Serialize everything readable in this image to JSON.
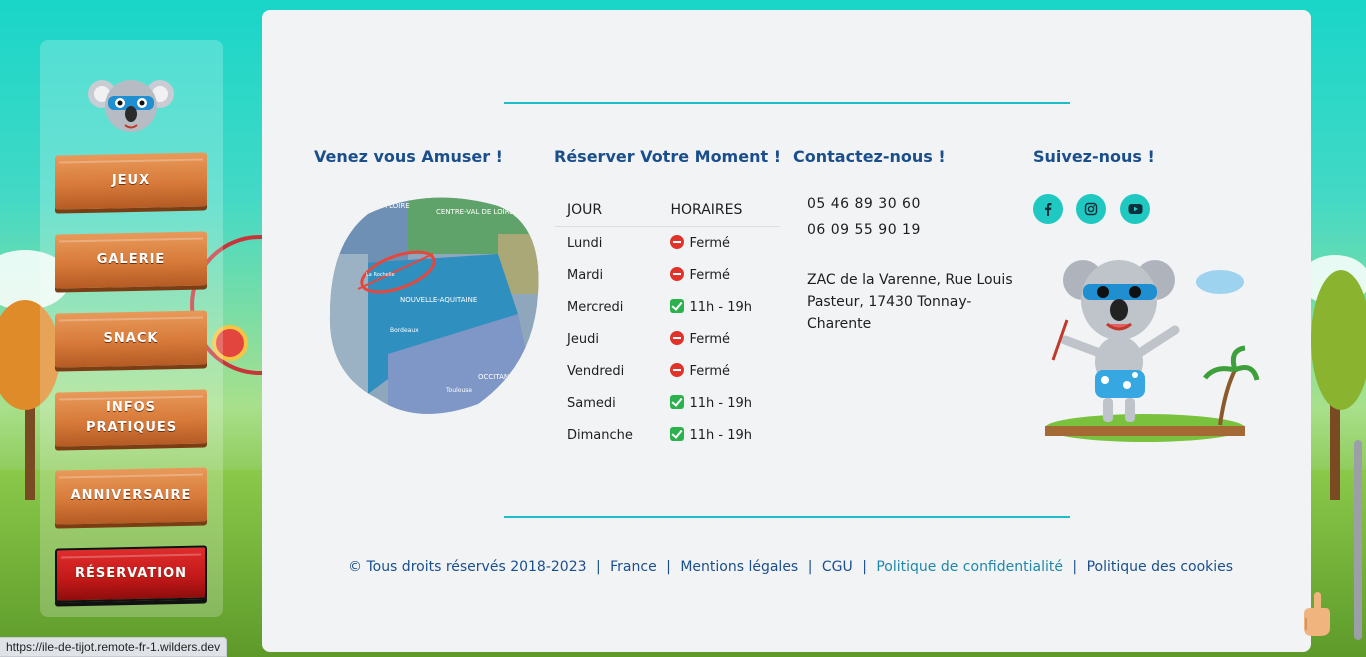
{
  "sidebar": {
    "items": [
      {
        "label": "JEUX"
      },
      {
        "label": "GALERIE"
      },
      {
        "label": "SNACK"
      },
      {
        "label": "INFOS PRATIQUES"
      },
      {
        "label": "ANNIVERSAIRE"
      },
      {
        "label": "RÉSERVATION"
      }
    ]
  },
  "columns": {
    "fun": {
      "title": "Venez vous Amuser !"
    },
    "booking": {
      "title": "Réserver Votre Moment !"
    },
    "contact": {
      "title": "Contactez-nous !"
    },
    "follow": {
      "title": "Suivez-nous !"
    }
  },
  "map_labels": {
    "region1": "DE LA LOIRE",
    "region2": "CENTRE-VAL DE LOIRE",
    "region3": "NOUVELLE-AQUITAINE",
    "city1": "Bordeaux",
    "city2": "La Rochelle",
    "region4": "OCCITANIE",
    "city3": "Toulouse"
  },
  "hours": {
    "col_day": "JOUR",
    "col_hours": "HORAIRES",
    "rows": [
      {
        "day": "Lundi",
        "status": "closed",
        "text": "Fermé"
      },
      {
        "day": "Mardi",
        "status": "closed",
        "text": "Fermé"
      },
      {
        "day": "Mercredi",
        "status": "open",
        "text": "11h - 19h"
      },
      {
        "day": "Jeudi",
        "status": "closed",
        "text": "Fermé"
      },
      {
        "day": "Vendredi",
        "status": "closed",
        "text": "Fermé"
      },
      {
        "day": "Samedi",
        "status": "open",
        "text": "11h - 19h"
      },
      {
        "day": "Dimanche",
        "status": "open",
        "text": "11h - 19h"
      }
    ]
  },
  "contact": {
    "phone1": "05 46 89 30 60",
    "phone2": "06 09 55 90 19",
    "address": "ZAC de la Varenne, Rue Louis Pasteur, 17430 Tonnay-Charente"
  },
  "social": [
    {
      "icon": "facebook-icon"
    },
    {
      "icon": "instagram-icon"
    },
    {
      "icon": "youtube-icon"
    }
  ],
  "footer": {
    "copyright": "© Tous droits réservés 2018-2023",
    "links": [
      {
        "label": "France",
        "style": "dark"
      },
      {
        "label": "Mentions légales",
        "style": "dark"
      },
      {
        "label": "CGU",
        "style": "dark"
      },
      {
        "label": "Politique de confidentialité",
        "style": "teal"
      },
      {
        "label": "Politique des cookies",
        "style": "dark"
      }
    ],
    "separator": "|"
  },
  "status_bar": {
    "url": "https://ile-de-tijot.remote-fr-1.wilders.dev"
  },
  "colors": {
    "accent": "#1fc8c0",
    "title": "#1a4f8c",
    "wood": "#d77a3a",
    "reservation": "#c11818"
  }
}
